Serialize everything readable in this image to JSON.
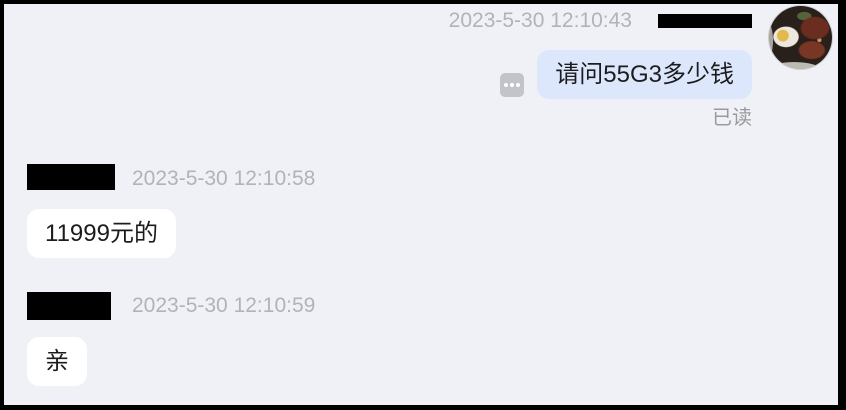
{
  "outgoing_message": {
    "timestamp": "2023-5-30 12:10:43",
    "text": "请问55G3多少钱",
    "read_status": "已读"
  },
  "incoming_messages": [
    {
      "timestamp": "2023-5-30 12:10:58",
      "text": "11999元的"
    },
    {
      "timestamp": "2023-5-30 12:10:59",
      "text": "亲"
    }
  ],
  "icons": {
    "more_button": "more-icon"
  },
  "colors": {
    "frame": "#000000",
    "chat_background": "#f0f1f6",
    "outgoing_bubble": "#dde7fb",
    "incoming_bubble": "#ffffff",
    "timestamp": "#b2b2b8",
    "read_status": "#9a9a9e",
    "message_text": "#1c1c1e",
    "more_button": "#c2c4ca",
    "redaction": "#000000"
  }
}
